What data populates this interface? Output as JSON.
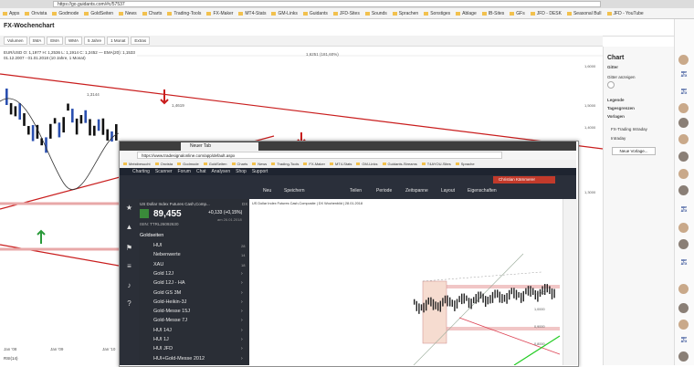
{
  "browser": {
    "url": "https://go.guidants.com/#c/57537",
    "bookmarks": [
      "Apps",
      "Onvista",
      "Godmode",
      "GoldSeiten",
      "News",
      "Charts",
      "Trading-Tools",
      "FX-Maker",
      "MT4-Stats",
      "GM-Links",
      "Guidants",
      "JFD-Sites",
      "Sounds",
      "Sprachen",
      "Sonstiges",
      "Ablage",
      "IB-Sites",
      "GFs",
      "JFD - DESK",
      "Seasonal Bull",
      "JFD - YouTube"
    ]
  },
  "page": {
    "title": "FX-Wochenchart",
    "toolbar": [
      "Volumen",
      "SMA",
      "EMA",
      "WMA",
      "5 Jahre",
      "1 Monat",
      "Extras"
    ],
    "legend_line1": "EUR/USD O: 1,1977  H: 1,2536  L: 1,1914  C: 1,2452  — EMA(20): 1,1533",
    "legend_line2": "01.12.2007 - 01.01.2018  (10 Jahre, 1 Monat)",
    "price_labels": [
      "1,6251 (181,60%)",
      "1,3144",
      "1,4619"
    ],
    "axis_labels": [
      "1,6000",
      "1,5000",
      "1,4000",
      "1,3000"
    ],
    "x_labels": [
      "Jan '08",
      "Jan '09",
      "Jan '10"
    ],
    "indicator_label": "RSI(14)"
  },
  "panel": {
    "title": "Chart",
    "sections": [
      {
        "label": "Gitter",
        "items": [
          "Gitter anzeigen"
        ]
      },
      {
        "label": "Legende",
        "items": []
      },
      {
        "label": "Tagesgrenzen",
        "items": []
      },
      {
        "label": "Vorlagen",
        "items": [
          "FX-Trading Intraday",
          "Intraday"
        ]
      }
    ],
    "new_button": "Neue Vorlage..."
  },
  "inner": {
    "tab_title": "Neuer Tab",
    "url": "https://www.tradesignalonline.com/app/default.aspx",
    "bookmarks": [
      "Meistbesucht",
      "Onvista",
      "Godmode",
      "GoldSeiten",
      "Charts",
      "News",
      "Trading-Tools",
      "FX-Maker",
      "MT4-Stats",
      "GM-Links",
      "Guidants-Streams",
      "T4AYOU-Sites",
      "Sprache"
    ],
    "menu": [
      "Charting",
      "Scanner",
      "Forum",
      "Chat",
      "Analysen",
      "Shop",
      "Support"
    ],
    "user": "Christian Kämmerer",
    "tools": [
      "Neu",
      "Speichern",
      "Teilen",
      "Periode",
      "Zeitspanne",
      "Layout",
      "Eigenschaften"
    ],
    "instrument": "US Dollar Index Futures Cash,Comp...",
    "instrument_tag": "DX",
    "price": "89,455",
    "change": "+0,133 (+0,15%)",
    "isin": "ISIN: TTRL26092630",
    "date": "am 26.01.2018",
    "chart_header": "US Dollar Index Futures Cash,Composite | DX Wochenbild | 28.01.2018",
    "watch_group": "Goldseiten",
    "watchlist": [
      {
        "name": "HUI",
        "val": "28"
      },
      {
        "name": "Nebenwerte",
        "val": "14"
      },
      {
        "name": "XAU",
        "val": "18"
      },
      {
        "name": "Gold 12J",
        "val": ""
      },
      {
        "name": "Gold 12J - HA",
        "val": ""
      },
      {
        "name": "Gold GS 3M",
        "val": ""
      },
      {
        "name": "Gold-Heikin-3J",
        "val": ""
      },
      {
        "name": "Gold-Messe 15J",
        "val": ""
      },
      {
        "name": "Gold-Messe 7J",
        "val": ""
      },
      {
        "name": "HUI 14J",
        "val": ""
      },
      {
        "name": "HUI 1J",
        "val": ""
      },
      {
        "name": "HUI JFD",
        "val": ""
      },
      {
        "name": "HUI+Gold-Messe 2012",
        "val": ""
      }
    ],
    "inner_axis": [
      "1,1000",
      "1,0000",
      "0,9000",
      "0,8000"
    ]
  }
}
